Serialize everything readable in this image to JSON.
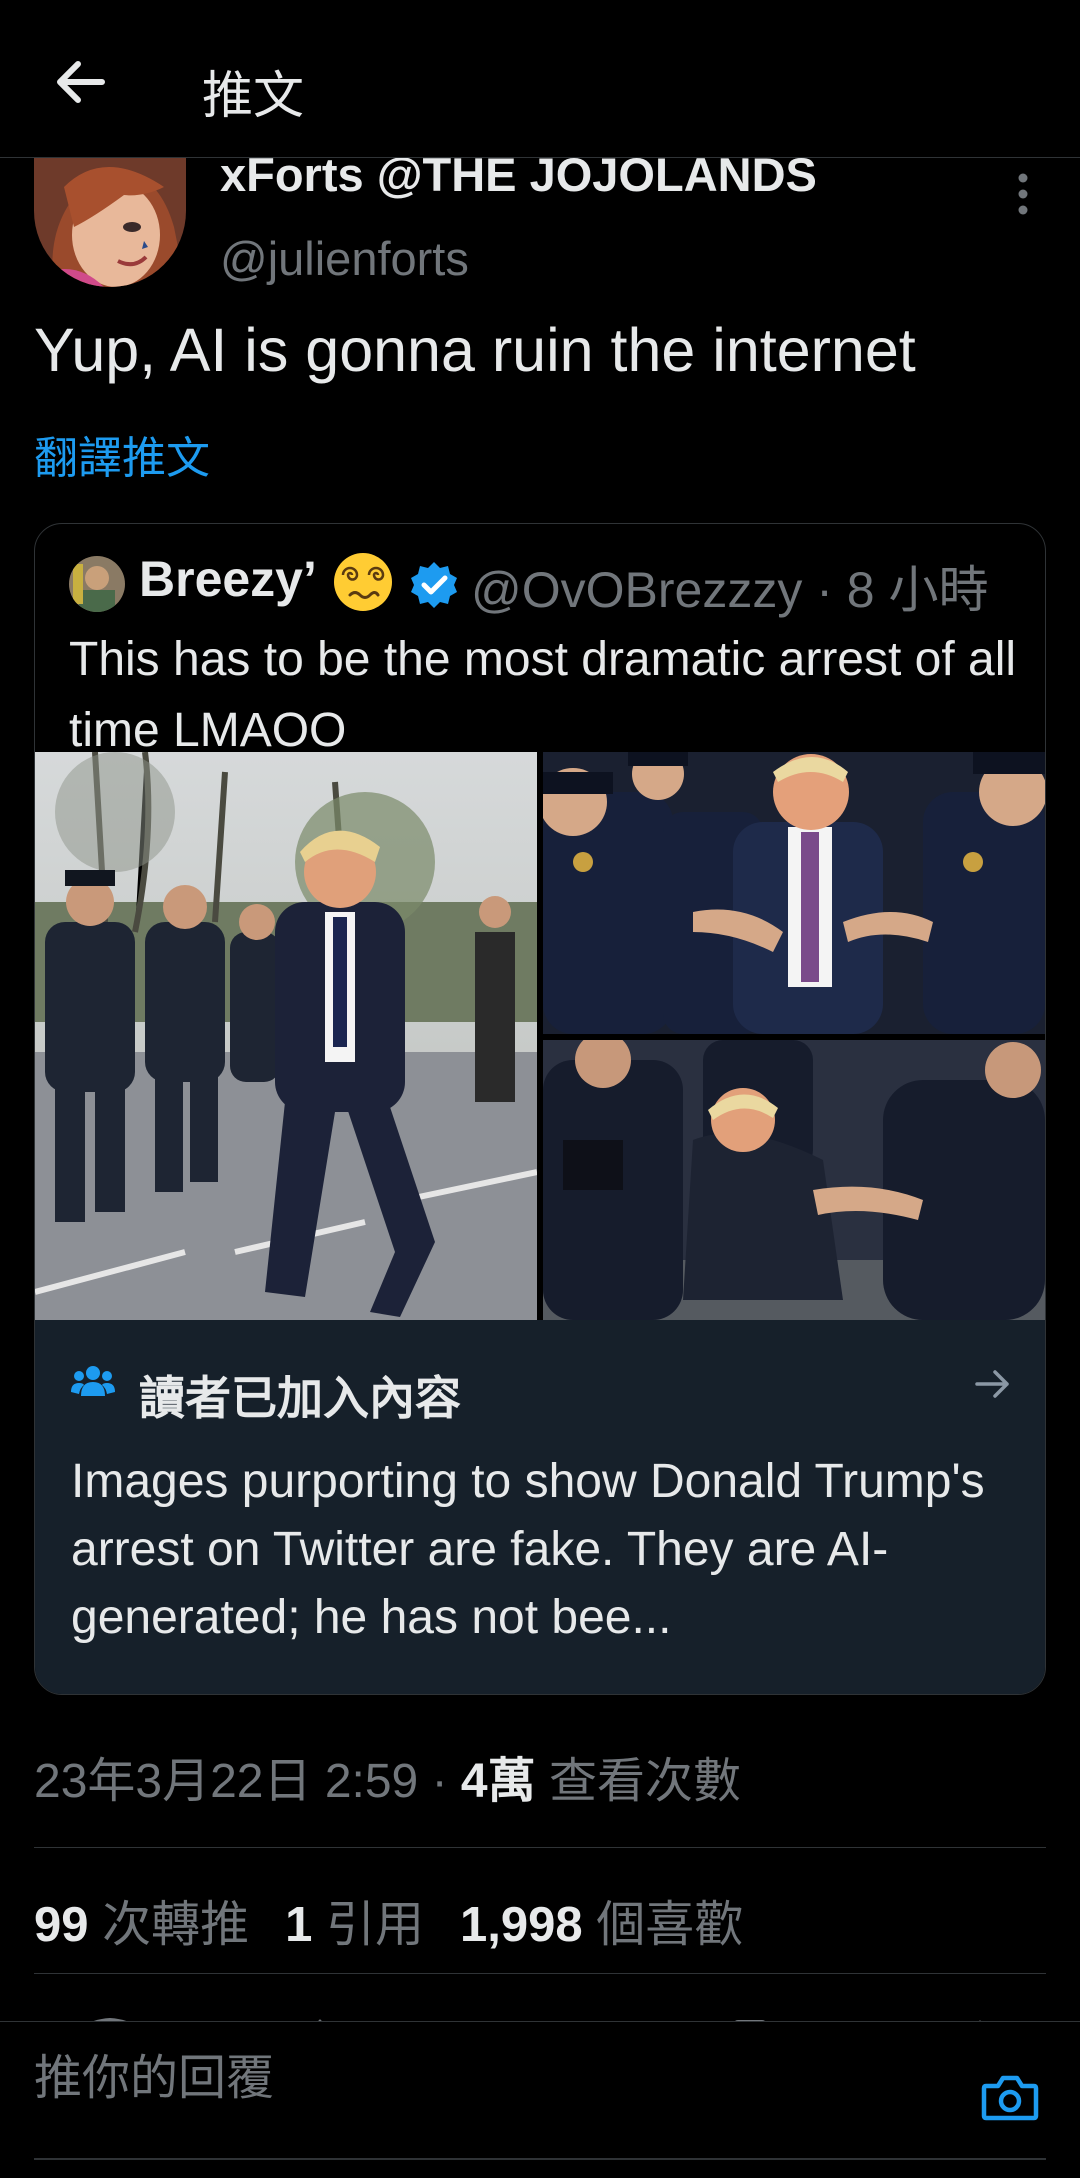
{
  "header": {
    "title": "推文",
    "back_icon": "arrow-left-icon"
  },
  "tweet": {
    "author_name": "xForts @THE JOJOLANDS",
    "author_handle": "@julienforts",
    "text": "Yup, AI is gonna ruin the internet",
    "translate_label": "翻譯推文",
    "more_icon": "more-vertical-icon"
  },
  "quote": {
    "author_name": "Breezy’",
    "emoji": "dizzy-face-emoji",
    "verified_icon": "verified-badge-icon",
    "handle_time": "@OvOBrezzzy · 8 小時",
    "text": "This has to be the most dramatic arrest of all time LMAOO",
    "images": [
      "photo-man-running-from-police",
      "photo-police-grabbing-man",
      "photo-police-tackling-man"
    ]
  },
  "community_note": {
    "title": "讀者已加入內容",
    "text": "Images purporting to show Donald Trump's arrest on Twitter are fake. They are AI-generated; he has not bee...",
    "icon": "people-icon",
    "arrow_icon": "arrow-right-icon"
  },
  "meta": {
    "timestamp": "23年3月22日 2:59",
    "separator": " · ",
    "views_count": "4萬",
    "views_label": " 查看次數"
  },
  "stats": {
    "retweets_count": "99",
    "retweets_label": " 次轉推",
    "quotes_count": "1",
    "quotes_label": " 引用",
    "likes_count": "1,998",
    "likes_label": " 個喜歡"
  },
  "reply": {
    "placeholder": "推你的回覆",
    "camera_icon": "camera-icon"
  },
  "colors": {
    "accent": "#1d9bf0",
    "background": "#000000",
    "muted": "#71767b",
    "note_bg": "#16202a"
  }
}
